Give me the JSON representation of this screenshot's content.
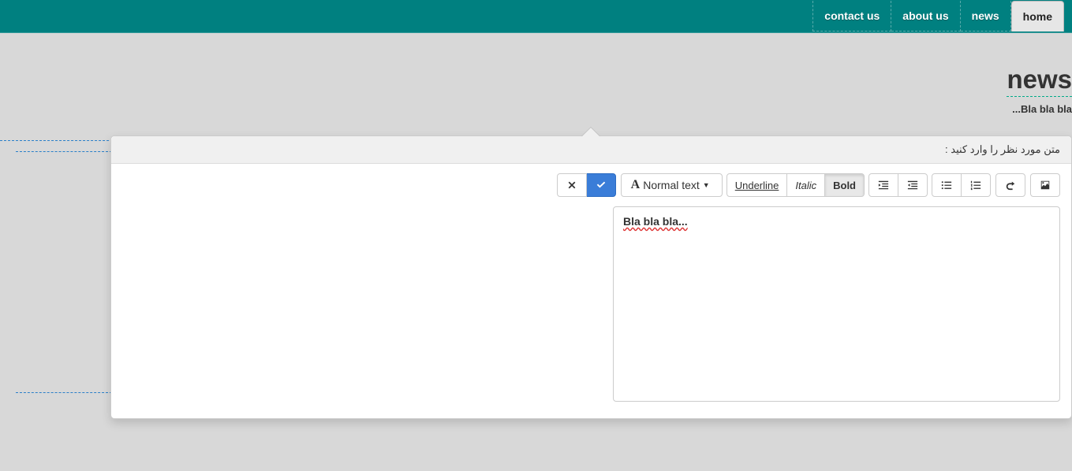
{
  "nav": {
    "contact": "contact us",
    "about": "about us",
    "news": "news",
    "home": "home"
  },
  "page": {
    "title": "news",
    "subtitle": "...Bla bla bla"
  },
  "popover": {
    "header": "متن مورد نظر را وارد کنید :"
  },
  "toolbar": {
    "bold": "Bold",
    "italic": "Italic",
    "underline": "Underline",
    "normal_text": "Normal text",
    "font_letter": "A"
  },
  "editor": {
    "content": "Bla bla bla..."
  }
}
